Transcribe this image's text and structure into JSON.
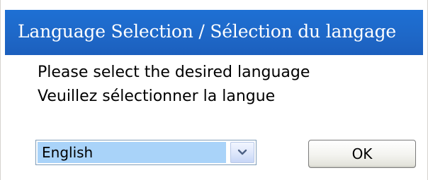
{
  "window": {
    "title": "Language Selection / Sélection du langage"
  },
  "message": {
    "line1": "Please select the desired language",
    "line2": "Veuillez sélectionner la langue"
  },
  "language_select": {
    "selected": "English"
  },
  "buttons": {
    "ok_label": "OK"
  },
  "colors": {
    "titlebar": "#1e68c8",
    "selection_highlight": "#a9d3f9"
  },
  "icons": {
    "dropdown": "chevron-down-icon"
  }
}
